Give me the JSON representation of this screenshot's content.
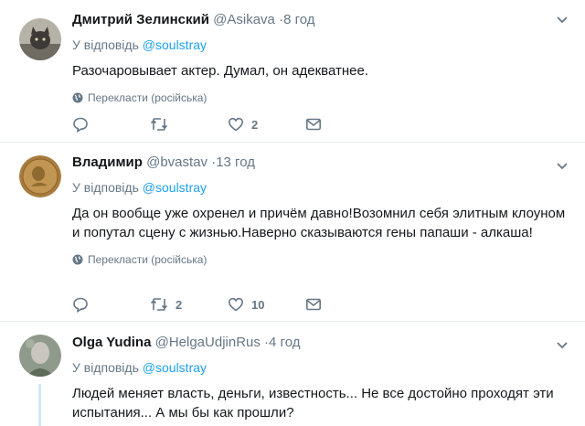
{
  "tweets": [
    {
      "name": "Дмитрий Зелинский",
      "handle": "@Asikava",
      "sep": "·",
      "time": "8 год",
      "reply_prefix": "У відповідь",
      "reply_to": "@soulstray",
      "text": "Разочаровывает актер. Думал, он адекватнее.",
      "translate": "Перекласти (російська)",
      "retweets": "",
      "likes": "2"
    },
    {
      "name": "Владимир",
      "handle": "@bvastav",
      "sep": "·",
      "time": "13 год",
      "reply_prefix": "У відповідь",
      "reply_to": "@soulstray",
      "text": "Да он вообще уже охренел и причём давно!Возомнил себя элитным клоуном и попутал сцену с жизнью.Наверно сказываются гены папаши - алкаша!",
      "translate": "Перекласти (російська)",
      "retweets": "2",
      "likes": "10"
    },
    {
      "name": "Olga Yudina",
      "handle": "@HelgaUdjinRus",
      "sep": "·",
      "time": "4 год",
      "reply_prefix": "У відповідь",
      "reply_to": "@soulstray",
      "text": "Людей меняет власть, деньги, известность... Не все достойно проходят эти испытания... А мы бы как прошли?"
    }
  ],
  "colors": {
    "accent": "#1da1f2",
    "secondary": "#657786",
    "divider": "#e6ecf0"
  }
}
